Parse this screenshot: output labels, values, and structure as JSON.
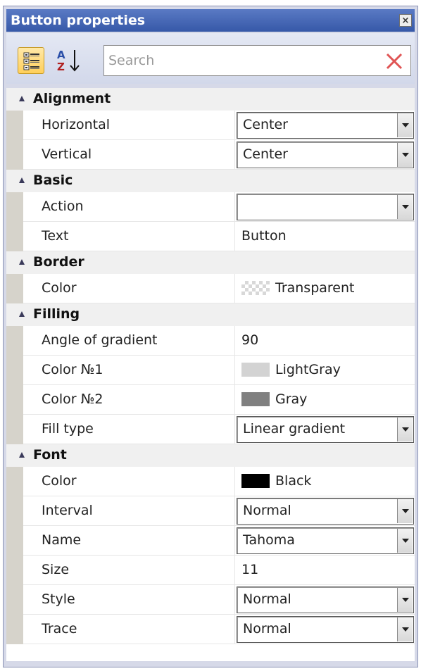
{
  "window": {
    "title": "Button properties",
    "close_glyph": "×"
  },
  "toolbar": {
    "categorized_icon": "categorized-view-icon",
    "alphabetical_icon": "sort-alphabetical-icon",
    "search": {
      "placeholder": "Search",
      "value": ""
    },
    "clear_icon": "clear-search-icon"
  },
  "colors": {
    "title_bar": "#3658a8",
    "category_bg": "#f0f0f0",
    "margin": "#d6d3cb",
    "clear_x": "#e05454",
    "lightgray": "#d3d3d3",
    "gray": "#808080",
    "black": "#000000"
  },
  "categories": [
    {
      "name": "Alignment",
      "props": [
        {
          "label": "Horizontal",
          "value": "Center",
          "editor": "dropdown"
        },
        {
          "label": "Vertical",
          "value": "Center",
          "editor": "dropdown"
        }
      ]
    },
    {
      "name": "Basic",
      "props": [
        {
          "label": "Action",
          "value": "",
          "editor": "dropdown"
        },
        {
          "label": "Text",
          "value": "Button",
          "editor": "text"
        }
      ]
    },
    {
      "name": "Border",
      "props": [
        {
          "label": "Color",
          "value": "Transparent",
          "editor": "color"
        }
      ]
    },
    {
      "name": "Filling",
      "props": [
        {
          "label": "Angle of gradient",
          "value": "90",
          "editor": "text"
        },
        {
          "label": "Color №1",
          "value": "LightGray",
          "editor": "color"
        },
        {
          "label": "Color №2",
          "value": "Gray",
          "editor": "color"
        },
        {
          "label": "Fill type",
          "value": "Linear gradient",
          "editor": "dropdown"
        }
      ]
    },
    {
      "name": "Font",
      "props": [
        {
          "label": "Color",
          "value": "Black",
          "editor": "color"
        },
        {
          "label": "Interval",
          "value": "Normal",
          "editor": "dropdown"
        },
        {
          "label": "Name",
          "value": "Tahoma",
          "editor": "dropdown"
        },
        {
          "label": "Size",
          "value": "11",
          "editor": "text"
        },
        {
          "label": "Style",
          "value": "Normal",
          "editor": "dropdown"
        },
        {
          "label": "Trace",
          "value": "Normal",
          "editor": "dropdown"
        }
      ]
    }
  ]
}
